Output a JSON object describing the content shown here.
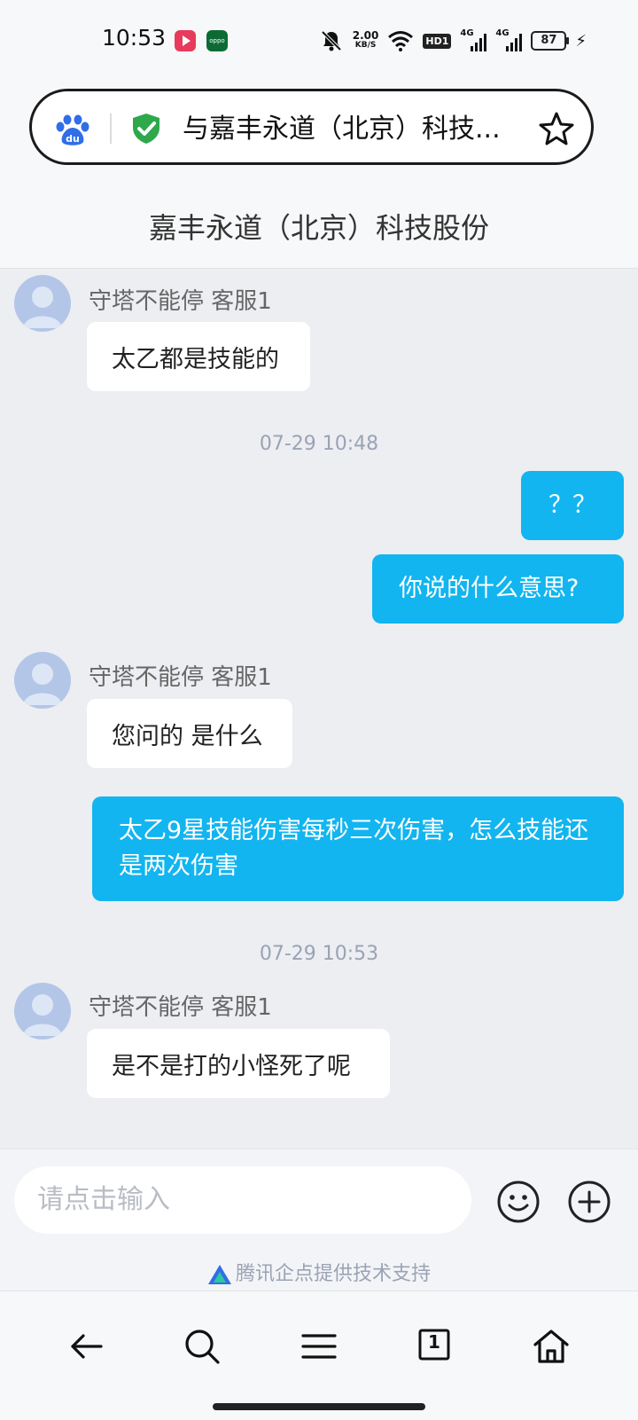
{
  "status_bar": {
    "time": "10:53",
    "net_speed_value": "2.00",
    "net_speed_unit": "KB/S",
    "hd_label": "HD1",
    "sim1_label": "4G",
    "sim2_label": "4G",
    "battery": "87",
    "app_badge_label": "oppo"
  },
  "address_bar": {
    "title": "与嘉丰永道（北京）科技...",
    "icons": [
      "baidu-logo",
      "secure-shield-icon",
      "star-icon"
    ]
  },
  "page": {
    "title": "嘉丰永道（北京）科技股份"
  },
  "chat": {
    "agent_name": "守塔不能停 客服1",
    "messages": [
      {
        "from": "agent",
        "text": "太乙都是技能的"
      },
      {
        "type": "timestamp",
        "text": "07-29 10:48"
      },
      {
        "from": "user",
        "text": "？？"
      },
      {
        "from": "user",
        "text": "你说的什么意思?"
      },
      {
        "from": "agent",
        "text": "您问的 是什么"
      },
      {
        "from": "user",
        "text": "太乙9星技能伤害每秒三次伤害，怎么技能还是两次伤害"
      },
      {
        "type": "timestamp",
        "text": "07-29 10:53"
      },
      {
        "from": "agent",
        "text": "是不是打的小怪死了呢"
      }
    ]
  },
  "input": {
    "placeholder": "请点击输入",
    "icons": [
      "emoji-icon",
      "plus-icon"
    ]
  },
  "footer": {
    "powered_by": "腾讯企点提供技术支持"
  },
  "toolbar": {
    "tab_count": "1",
    "icons": [
      "back-arrow-icon",
      "search-icon",
      "menu-icon",
      "tabs-icon",
      "home-icon"
    ]
  },
  "colors": {
    "user_bubble": "#12b5ef",
    "agent_bubble": "#ffffff",
    "chat_background": "#eceef2",
    "secure_green": "#2ea84a",
    "baidu_blue": "#2f6ee7"
  }
}
